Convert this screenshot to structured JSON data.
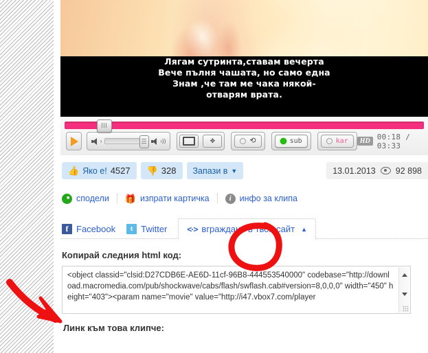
{
  "video": {
    "caption_lines": [
      "Лягам сутринта,ставам вечерта",
      "Вече пълня чашата, но само една",
      "Знам ,че там ме чака някой-",
      "отварям врата."
    ]
  },
  "player": {
    "play_label": "play",
    "quality_badge": "HD",
    "time": "00:18 / 03:33",
    "sub_label": "sub",
    "kar_label": "kar",
    "progress_percent": 9,
    "volume_percent": 95
  },
  "actions": {
    "like_label": "Яко е!",
    "like_count": "4527",
    "dislike_count": "328",
    "save_label": "Запази в",
    "date": "13.01.2013",
    "views": "92 898"
  },
  "share": {
    "share_label": "сподели",
    "postcard_label": "изпрати картичка",
    "info_label": "инфо за клипа"
  },
  "tabs": [
    {
      "label": "Facebook",
      "icon": "facebook-icon"
    },
    {
      "label": "Twitter",
      "icon": "twitter-icon"
    },
    {
      "label": "вграждане в твоя сайт",
      "icon": "embed-code-icon"
    }
  ],
  "embed": {
    "heading": "Копирай следния html код:",
    "code": "<object classid=\"clsid:D27CDB6E-AE6D-11cf-96B8-444553540000\" codebase=\"http://download.macromedia.com/pub/shockwave/cabs/flash/swflash.cab#version=8,0,0,0\" width=\"450\" height=\"403\"><param name=\"movie\" value=\"http://i47.vbox7.com/player"
  },
  "link_section": {
    "heading": "Линк към това клипче:"
  },
  "colors": {
    "accent_pink": "#f52f7e",
    "link_blue": "#2b5fd0",
    "button_blue_bg": "#d4e7f8",
    "annotation_red": "#ee1111",
    "play_orange": "#f59b1c"
  }
}
